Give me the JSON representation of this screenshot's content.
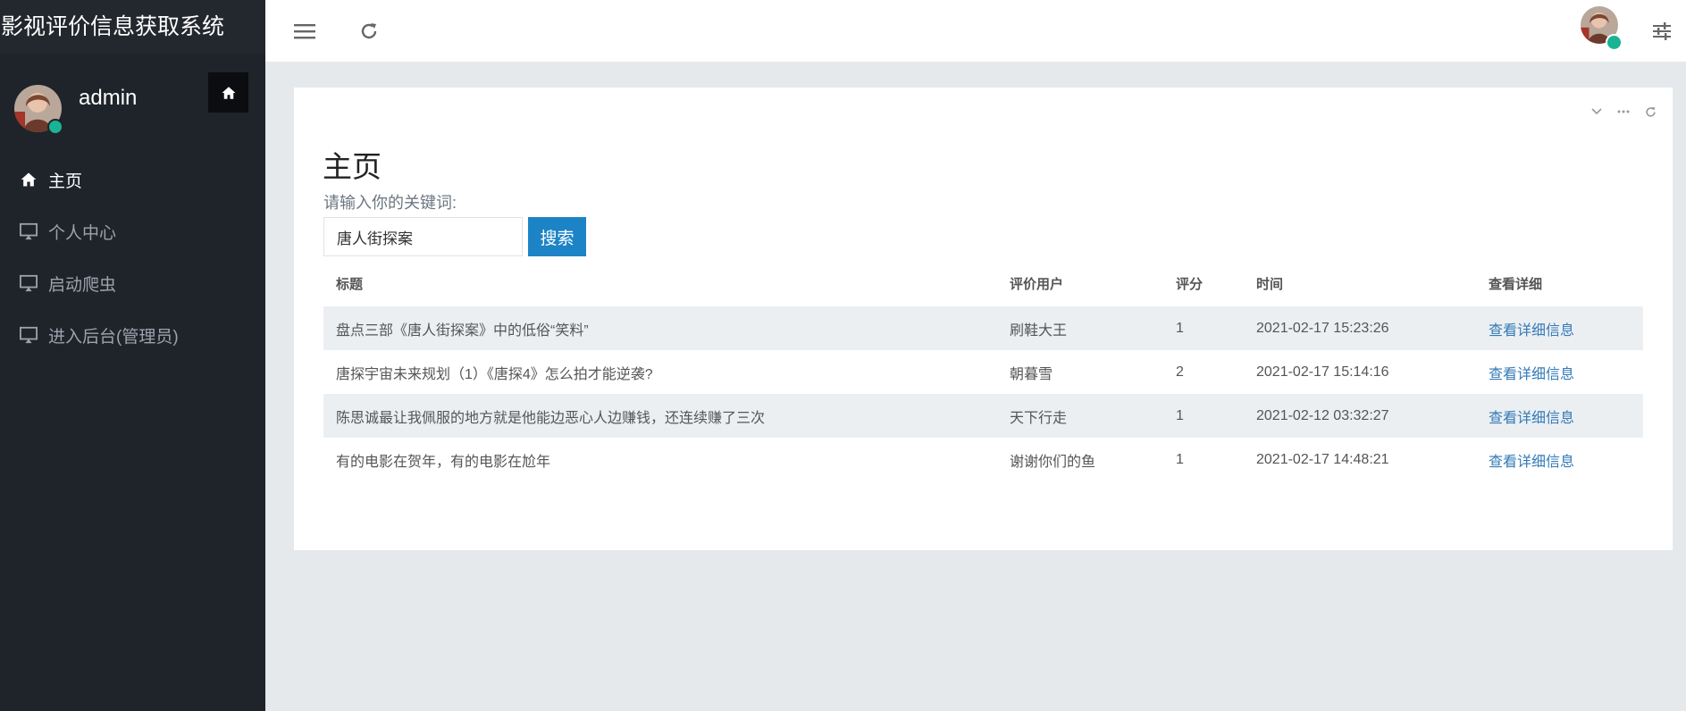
{
  "app": {
    "title": "影视评价信息获取系统"
  },
  "sidebar": {
    "username": "admin",
    "items": [
      {
        "label": "主页",
        "icon": "home-icon"
      },
      {
        "label": "个人中心",
        "icon": "monitor-icon"
      },
      {
        "label": "启动爬虫",
        "icon": "monitor-icon"
      },
      {
        "label": "进入后台(管理员)",
        "icon": "monitor-icon"
      }
    ]
  },
  "page": {
    "title": "主页",
    "keyword_label": "请输入你的关键词:",
    "search_value": "唐人街探案",
    "search_button": "搜索"
  },
  "table": {
    "headers": [
      "标题",
      "评价用户",
      "评分",
      "时间",
      "查看详细"
    ],
    "rows": [
      {
        "title": "盘点三部《唐人街探案》中的低俗“笑料”",
        "user": "刷鞋大王",
        "score": "1",
        "time": "2021-02-17 15:23:26",
        "link": "查看详细信息"
      },
      {
        "title": "唐探宇宙未来规划（1）《唐探4》怎么拍才能逆袭?",
        "user": "朝暮雪",
        "score": "2",
        "time": "2021-02-17 15:14:16",
        "link": "查看详细信息"
      },
      {
        "title": "陈思诚最让我佩服的地方就是他能边恶心人边赚钱，还连续赚了三次",
        "user": "天下行走",
        "score": "1",
        "time": "2021-02-12 03:32:27",
        "link": "查看详细信息"
      },
      {
        "title": "有的电影在贺年，有的电影在尬年",
        "user": "谢谢你们的鱼",
        "score": "1",
        "time": "2021-02-17 14:48:21",
        "link": "查看详细信息"
      }
    ]
  },
  "colors": {
    "sidebar_bg": "#1f242b",
    "accent": "#1c84c6",
    "online": "#1ab394",
    "link": "#337ab7"
  }
}
